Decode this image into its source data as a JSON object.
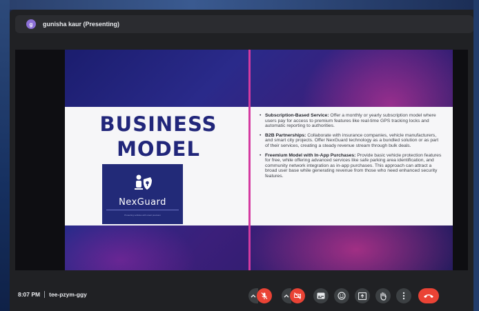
{
  "presenter": {
    "avatar_initial": "g",
    "label": "gunisha kaur (Presenting)"
  },
  "slide": {
    "title_line1": "Business",
    "title_line2": "Model",
    "logo_text": "NexGuard",
    "logo_tagline": "Protecting vehicles with smart precision",
    "bullets": [
      {
        "heading": "Subscription-Based Service:",
        "body": " Offer a monthly or yearly subscription model where users pay for access to premium features like real-time GPS tracking locks and automatic reporting to authorities."
      },
      {
        "heading": "B2B Partnerships:",
        "body": " Collaborate with insurance companies, vehicle manufacturers, and smart city projects. Offer NexGuard technology as a bundled solution or as part of their services, creating a steady revenue stream through bulk deals."
      },
      {
        "heading": "Freemium Model with In-App Purchases:",
        "body": " Provide basic vehicle protection features for free, while offering advanced services like safe parking area identification, and community network integration as in-app purchases. This approach can attract a broad user base while generating revenue from those who need enhanced security features."
      }
    ]
  },
  "meeting": {
    "time": "8:07 PM",
    "code": "tee-pzym-ggy"
  },
  "controls": {
    "mic": "mic-off-icon",
    "camera": "camera-off-icon",
    "captions": "captions-icon",
    "reactions": "emoji-icon",
    "present": "present-screen-icon",
    "raise_hand": "raise-hand-icon",
    "more": "more-vert-icon",
    "end_call": "end-call-icon"
  },
  "colors": {
    "slide_title": "#21267a",
    "accent_magenta": "#d43aa0",
    "end_call_red": "#ea4335",
    "avatar_purple": "#8b6fd6"
  }
}
